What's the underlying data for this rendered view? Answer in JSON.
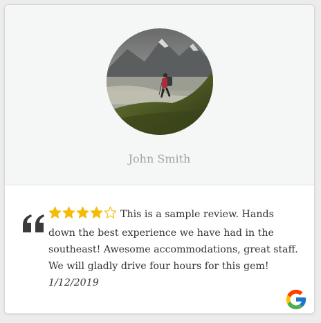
{
  "reviewer": {
    "name": "John Smith"
  },
  "review": {
    "rating": 4,
    "max_rating": 5,
    "text": "This is a sample review. Hands down the best experience we have had in the southeast! Awesome accommodations, great staff. We will gladly drive four hours for this gem!",
    "date": "1/12/2019"
  },
  "quote_mark": "❝",
  "colors": {
    "star_filled": "#f6bb06",
    "star_outline": "#f6bb06",
    "name_text": "#a2a2a2",
    "body_text": "#333333",
    "card_top_bg": "#f5f6f6"
  },
  "icons": {
    "source_logo": "google-g-icon",
    "avatar": "hiker-photo"
  }
}
